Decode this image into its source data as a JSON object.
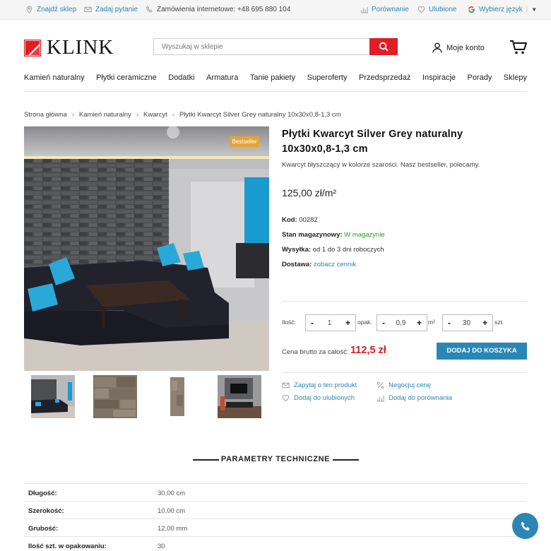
{
  "topbar": {
    "find_store": "Znajdź sklep",
    "ask_question": "Zadaj pytanie",
    "phone_orders": "Zamówienia internetowe: +48 695 880 104",
    "compare": "Porównanie",
    "favorites": "Ulubione",
    "language": "Wybierz język",
    "language_arrow": "▼"
  },
  "header": {
    "logo": "KLINK",
    "search_placeholder": "Wyszukaj w sklepie",
    "account": "Moje konto"
  },
  "nav": [
    "Kamień naturalny",
    "Płytki ceramiczne",
    "Dodatki",
    "Armatura",
    "Tanie pakiety",
    "Superoferty",
    "Przedsprzedaż",
    "Inspiracje",
    "Porady",
    "Sklepy"
  ],
  "breadcrumb": [
    "Strona główna",
    "Kamień naturalny",
    "Kwarcyt",
    "Płytki Kwarcyt Silver Grey naturalny 10x30x0,8-1,3 cm"
  ],
  "breadcrumb_sep": "›",
  "gallery": {
    "badge": "Bestseller"
  },
  "product": {
    "title": "Płytki Kwarcyt Silver Grey naturalny 10x30x0,8-1,3 cm",
    "description": "Kwarcyt błyszczący w kolorze szarości. Nasz bestseller, polecamy.",
    "price": "125,00 zł/m²",
    "code_label": "Kod:",
    "code": "00282",
    "stock_label": "Stan magazynowy:",
    "stock": "W magazynie",
    "shipping_label": "Wysyłka:",
    "shipping": "od 1 do 3 dni roboczych",
    "delivery_label": "Dostawa:",
    "delivery": "zobacz cennik"
  },
  "quantity": {
    "label": "Ilość:",
    "minus": "-",
    "plus": "+",
    "packs_value": "1",
    "packs_unit": "opak.",
    "area_value": "0,9",
    "area_unit": "m²",
    "pieces_value": "30",
    "pieces_unit": "szt."
  },
  "total": {
    "label": "Cena brutto za całość:",
    "value": "112,5 zł",
    "button": "DODAJ DO KOSZYKA"
  },
  "actions": {
    "ask": "Zapytaj o ten produkt",
    "negotiate": "Negocjuj cenę",
    "favorite": "Dodaj do ulubionych",
    "compare": "Dodaj do porównania"
  },
  "params": {
    "title": "PARAMETRY TECHNICZNE",
    "rows": [
      {
        "k": "Długość:",
        "v": "30,00 cm"
      },
      {
        "k": "Szerokość:",
        "v": "10,00 cm"
      },
      {
        "k": "Grubość:",
        "v": "12,00 mm"
      },
      {
        "k": "Ilość szt. w opakowaniu:",
        "v": "30"
      }
    ]
  },
  "colors": {
    "accent_blue": "#2a86b5",
    "brand_red": "#e01e26",
    "price_red": "#d01f26",
    "badge_orange": "#e4a43a",
    "stock_green": "#2a9a2a"
  }
}
